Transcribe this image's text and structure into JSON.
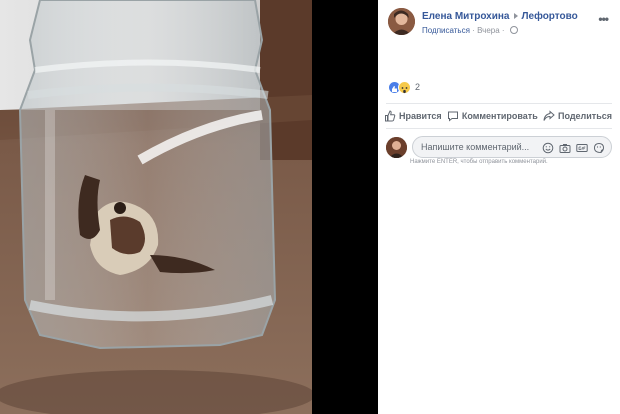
{
  "post": {
    "author": "Елена Митрохина",
    "location": "Лефортово",
    "subscribe_label": "Подписаться",
    "separator": "·",
    "time": "Вчера",
    "more_label": "•••"
  },
  "reactions": {
    "icons": [
      "like-icon",
      "wow-icon"
    ],
    "count": "2"
  },
  "actions": {
    "like": "Нравится",
    "comment": "Комментировать",
    "share": "Поделиться"
  },
  "comment_box": {
    "placeholder": "Напишите комментарий...",
    "icons": [
      "emoji-icon",
      "camera-icon",
      "gif-icon",
      "sticker-icon"
    ],
    "hint": "Нажмите ENTER, чтобы отправить комментарий."
  },
  "colors": {
    "link": "#365899",
    "muted": "#90949c",
    "action_text": "#606770",
    "like_blue": "#4a7ee8",
    "wow_yellow": "#f6c94a"
  }
}
